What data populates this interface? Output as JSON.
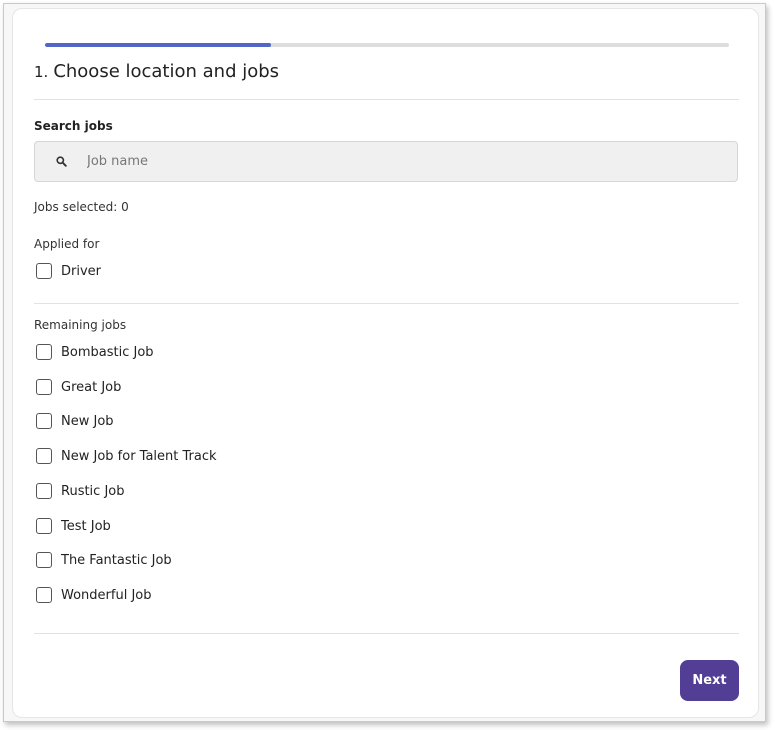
{
  "progress": {
    "value": 0.33
  },
  "step": {
    "number": "1.",
    "title": "Choose location and jobs"
  },
  "search": {
    "label": "Search jobs",
    "placeholder": "Job name",
    "value": "",
    "icon": "search-icon"
  },
  "jobs_selected": "Jobs selected: 0",
  "applied_for": {
    "heading": "Applied for",
    "items": [
      {
        "label": "Driver",
        "checked": false
      }
    ]
  },
  "remaining_jobs": {
    "heading": "Remaining jobs",
    "items": [
      {
        "label": "Bombastic Job",
        "checked": false
      },
      {
        "label": "Great Job",
        "checked": false
      },
      {
        "label": "New Job",
        "checked": false
      },
      {
        "label": "New Job for Talent Track",
        "checked": false
      },
      {
        "label": "Rustic Job",
        "checked": false
      },
      {
        "label": "Test Job",
        "checked": false
      },
      {
        "label": "The Fantastic Job",
        "checked": false
      },
      {
        "label": "Wonderful Job",
        "checked": false
      }
    ]
  },
  "next_button": {
    "label": "Next"
  },
  "colors": {
    "progress": "#5266c8",
    "progress_track": "#dddddd",
    "next_button": "#523e94"
  }
}
